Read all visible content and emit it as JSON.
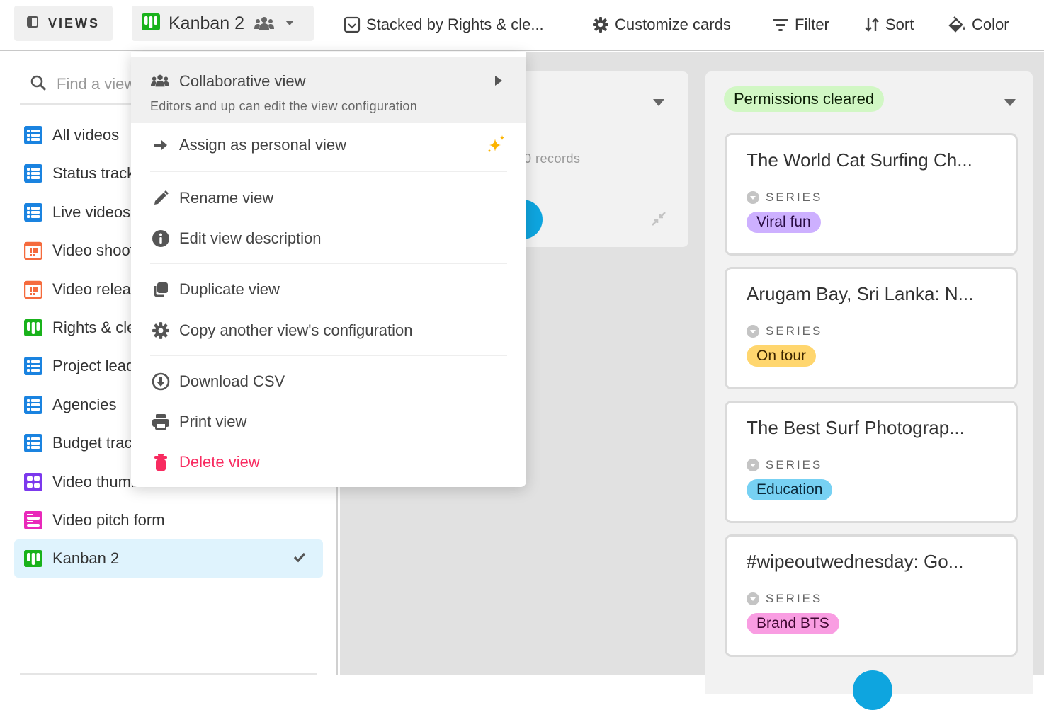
{
  "topbar": {
    "views_label": "VIEWS",
    "current_view": "Kanban 2",
    "stacked_by": "Stacked by Rights & cle...",
    "customize_cards": "Customize cards",
    "filter": "Filter",
    "sort": "Sort",
    "color": "Color"
  },
  "sidebar": {
    "search_placeholder": "Find a view",
    "items": [
      {
        "label": "All videos",
        "type": "grid",
        "color": "#1a83e0"
      },
      {
        "label": "Status tracker",
        "type": "grid",
        "color": "#1a83e0"
      },
      {
        "label": "Live videos",
        "type": "grid",
        "color": "#1a83e0"
      },
      {
        "label": "Video shoots",
        "type": "calendar",
        "color": "#f56b3d"
      },
      {
        "label": "Video releases",
        "type": "calendar",
        "color": "#f56b3d"
      },
      {
        "label": "Rights & clearances",
        "type": "kanban",
        "color": "#19b21b"
      },
      {
        "label": "Project leads",
        "type": "grid",
        "color": "#1a83e0"
      },
      {
        "label": "Agencies",
        "type": "grid",
        "color": "#1a83e0"
      },
      {
        "label": "Budget tracker",
        "type": "grid",
        "color": "#1a83e0"
      },
      {
        "label": "Video thumbnails",
        "type": "gallery",
        "color": "#7c39ed"
      },
      {
        "label": "Video pitch form",
        "type": "form",
        "color": "#e929ba"
      },
      {
        "label": "Kanban 2",
        "type": "kanban",
        "color": "#19b21b",
        "active": true
      }
    ]
  },
  "menu": {
    "collab_title": "Collaborative view",
    "collab_sub": "Editors and up can edit the view configuration",
    "assign_personal": "Assign as personal view",
    "rename": "Rename view",
    "edit_description": "Edit view description",
    "duplicate": "Duplicate view",
    "copy_config": "Copy another view's configuration",
    "download_csv": "Download CSV",
    "print": "Print view",
    "delete": "Delete view"
  },
  "board": {
    "column1": {
      "records_text": "0 records"
    },
    "column2": {
      "stack_label": "Permissions cleared",
      "stack_color": "#d1f7c4",
      "cards": [
        {
          "title": "The World Cat Surfing Ch...",
          "field": "SERIES",
          "tag": "Viral fun",
          "tag_color": "#cdb0ff",
          "tag_text": "#280b42"
        },
        {
          "title": "Arugam Bay, Sri Lanka: N...",
          "field": "SERIES",
          "tag": "On tour",
          "tag_color": "#ffd66e",
          "tag_text": "#3d2600"
        },
        {
          "title": "The Best Surf Photograp...",
          "field": "SERIES",
          "tag": "Education",
          "tag_color": "#77d1f3",
          "tag_text": "#0b2a3b"
        },
        {
          "title": "#wipeoutwednesday: Go...",
          "field": "SERIES",
          "tag": "Brand BTS",
          "tag_color": "#f99de2",
          "tag_text": "#400832"
        }
      ]
    }
  }
}
